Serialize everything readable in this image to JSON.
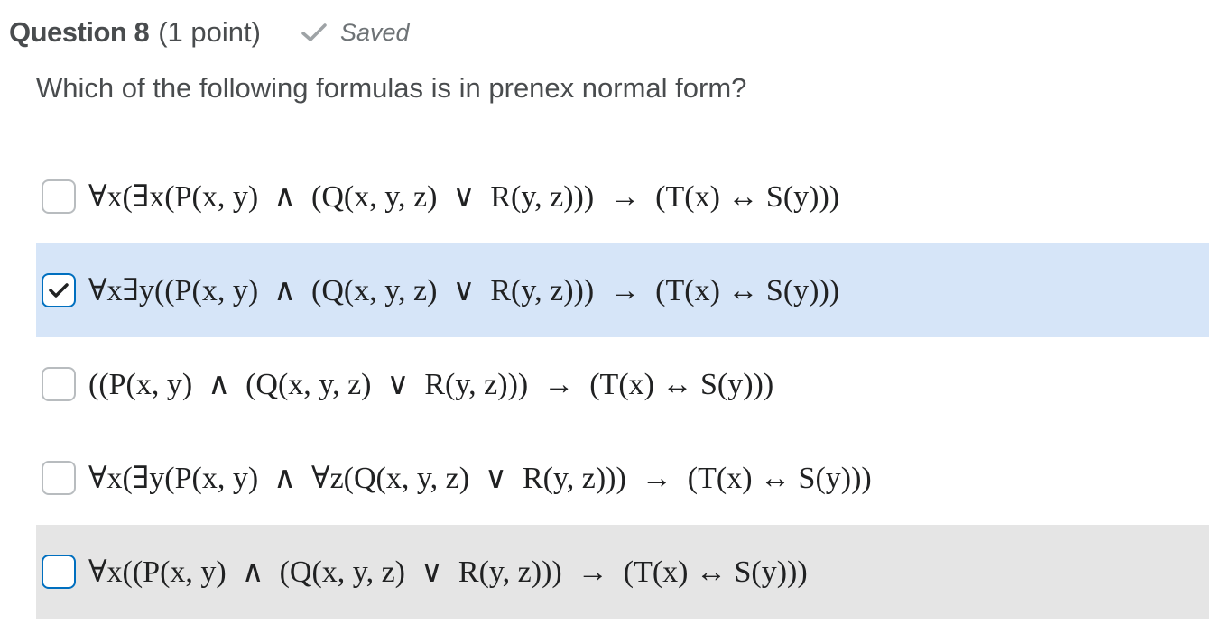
{
  "header": {
    "question_title": "Question 8",
    "points": "(1 point)",
    "status": "Saved",
    "status_icon": "checkmark-icon"
  },
  "prompt": "Which of the following formulas is in prenex normal form?",
  "options": [
    {
      "formula": "∀x(∃x(P(x, y)  ∧  (Q(x, y, z)  ∨  R(y, z)))  →  (T(x) ↔ S(y)))",
      "checked": false
    },
    {
      "formula": "∀x∃y((P(x, y)  ∧  (Q(x, y, z)  ∨  R(y, z)))  →  (T(x) ↔ S(y)))",
      "checked": true
    },
    {
      "formula": "((P(x, y)  ∧  (Q(x, y, z)  ∨  R(y, z)))  →  (T(x) ↔ S(y)))",
      "checked": false
    },
    {
      "formula": "∀x(∃y(P(x, y)  ∧  ∀z(Q(x, y, z)  ∨  R(y, z)))  →  (T(x) ↔ S(y)))",
      "checked": false
    },
    {
      "formula": "∀x((P(x, y)  ∧  (Q(x, y, z)  ∨  R(y, z)))  →  (T(x) ↔ S(y)))",
      "checked": false
    }
  ],
  "colors": {
    "selected_background": "#d6e5f8",
    "hover_background": "#e5e5e5",
    "accent": "#006fbf"
  }
}
